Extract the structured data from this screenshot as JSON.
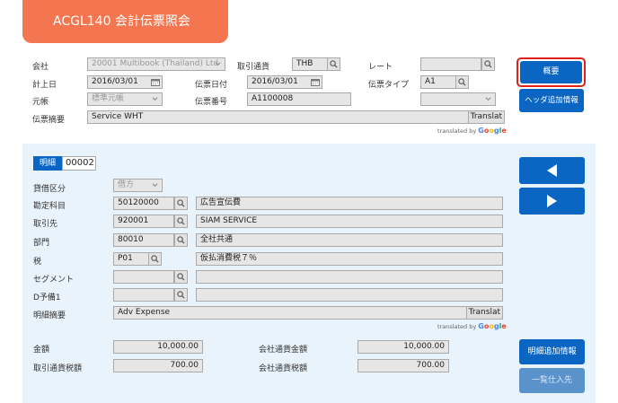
{
  "title": "ACGL140 会計伝票照会",
  "header": {
    "company_label": "会社",
    "company_value": "20001 Multibook (Thailand) Ltd",
    "currency_label": "取引通貨",
    "currency_value": "THB",
    "rate_label": "レート",
    "rate_value": "",
    "posting_date_label": "計上日",
    "posting_date_value": "2016/03/01",
    "slip_date_label": "伝票日付",
    "slip_date_value": "2016/03/01",
    "slip_type_label": "伝票タイプ",
    "slip_type_value": "A1",
    "ledger_label": "元帳",
    "ledger_value": "標準元帳",
    "slip_no_label": "伝票番号",
    "slip_no_value": "A1100008",
    "extra_select_value": "",
    "summary_label": "伝票摘要",
    "summary_value": "Service WHT",
    "translate_label": "Translat",
    "translated_by": "translated by",
    "google": "Google"
  },
  "buttons": {
    "overview": "概要",
    "header_extra": "ヘッダ追加情報",
    "line_extra": "明細追加情報",
    "purchase_list": "一覧仕入先"
  },
  "detail": {
    "line_label": "明細",
    "line_no": "00002",
    "dc_label": "貸借区分",
    "dc_value": "借方",
    "account_label": "勘定科目",
    "account_code": "50120000",
    "account_name": "広告宣伝費",
    "partner_label": "取引先",
    "partner_code": "920001",
    "partner_name": "SIAM SERVICE",
    "dept_label": "部門",
    "dept_code": "80010",
    "dept_name": "全社共通",
    "tax_label": "税",
    "tax_code": "P01",
    "tax_name": "仮払消費税７％",
    "segment_label": "セグメント",
    "segment_code": "",
    "segment_name": "",
    "d_reserve_label": "D予備1",
    "d_reserve_code": "",
    "d_reserve_name": "",
    "line_summary_label": "明細摘要",
    "line_summary_value": "Adv Expense",
    "amount_label": "金額",
    "amount_value": "10,000.00",
    "company_amount_label": "会社通貨金額",
    "company_amount_value": "10,000.00",
    "tx_tax_label": "取引通貨税額",
    "tx_tax_value": "700.00",
    "company_tax_label": "会社通貨税額",
    "company_tax_value": "700.00"
  },
  "colors": {
    "accent": "#f47650",
    "primary": "#0a66c2",
    "detail_bg": "#e8f3fb",
    "focus_ring": "#e0201b"
  }
}
